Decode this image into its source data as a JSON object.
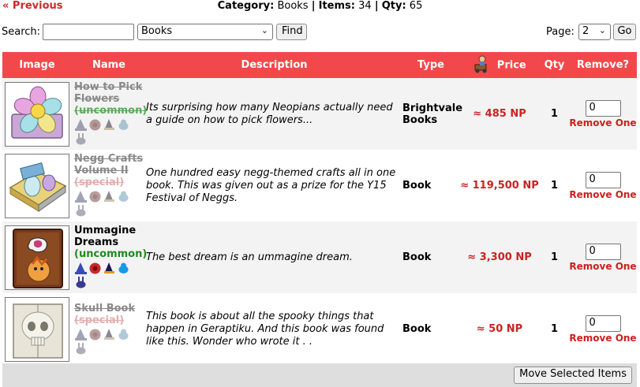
{
  "nav": {
    "previous_label": "« Previous"
  },
  "summary": {
    "category_label": "Category:",
    "category_value": "Books",
    "items_label": "Items:",
    "items_value": "34",
    "qty_label": "Qty:",
    "qty_value": "65",
    "separator": "|"
  },
  "controls": {
    "search_label": "Search:",
    "search_value": "",
    "category_select": "Books",
    "find_label": "Find",
    "page_label": "Page:",
    "page_select": "2",
    "go_label": "Go"
  },
  "table": {
    "headers": [
      "Image",
      "Name",
      "Description",
      "Type",
      "Price",
      "Qty",
      "Remove?"
    ],
    "rows": [
      {
        "name": "How to Pick Flowers",
        "name_struck": true,
        "rarity": "(uncommon)",
        "rarity_class": "uncommon",
        "rarity_struck": true,
        "description": "Its surprising how many Neopians actually need a guide on how to pick flowers...",
        "type": "Brightvale Books",
        "price": "≈ 485 NP",
        "qty": "1",
        "remove_value": "0",
        "remove_label": "Remove One",
        "image_icon": "flower-book-icon"
      },
      {
        "name": "Negg Crafts Volume II",
        "name_struck": true,
        "rarity": "(special)",
        "rarity_class": "special",
        "rarity_struck": true,
        "description": "One hundred easy negg-themed crafts all in one book. This was given out as a prize for the Y15 Festival of Neggs.",
        "type": "Book",
        "price": "≈ 119,500 NP",
        "qty": "1",
        "remove_value": "0",
        "remove_label": "Remove One",
        "image_icon": "negg-crafts-book-icon"
      },
      {
        "name": "Ummagine Dreams",
        "name_struck": false,
        "rarity": "(uncommon)",
        "rarity_class": "uncommon",
        "rarity_struck": false,
        "description": "The best dream is an ummagine dream.",
        "type": "Book",
        "price": "≈ 3,300 NP",
        "qty": "1",
        "remove_value": "0",
        "remove_label": "Remove One",
        "image_icon": "ummagine-book-icon"
      },
      {
        "name": "Skull Book",
        "name_struck": true,
        "rarity": "(special)",
        "rarity_class": "special",
        "rarity_struck": true,
        "description": "This book is about all the spooky things that happen in Geraptiku. And this book was found like this. Wonder who wrote it . .",
        "type": "Book",
        "price": "≈ 50 NP",
        "qty": "1",
        "remove_value": "0",
        "remove_label": "Remove One",
        "image_icon": "skull-book-icon"
      }
    ]
  },
  "footer": {
    "move_label": "Move Selected Items"
  },
  "colors": {
    "header_red": "#f2484b",
    "price_red": "#cc2222",
    "uncommon_green": "#1f8a1f"
  }
}
